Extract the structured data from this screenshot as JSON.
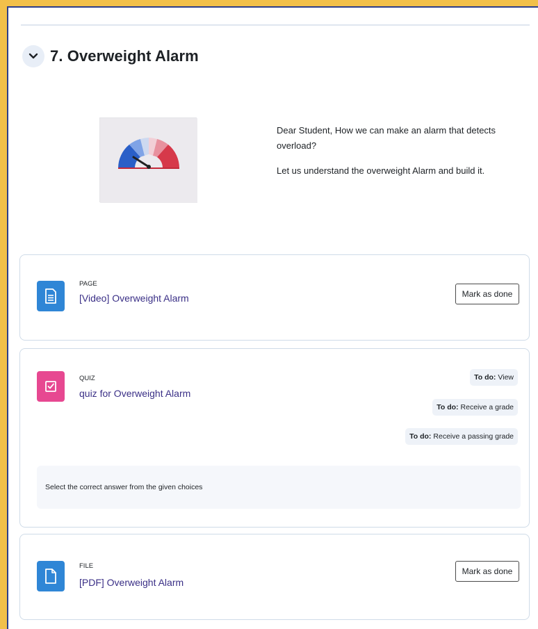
{
  "section": {
    "title": "7. Overweight Alarm",
    "summary": [
      "Dear Student, How we can make an alarm that detects overload?",
      "Let us understand the overweight Alarm and build it."
    ]
  },
  "activities": [
    {
      "type": "PAGE",
      "name": "[Video] Overweight Alarm",
      "icon": "page-icon",
      "button": "Mark as done"
    },
    {
      "type": "QUIZ",
      "name": "quiz for Overweight Alarm",
      "icon": "quiz-icon",
      "todo_prefix": "To do:",
      "todos": [
        "View",
        "Receive a grade",
        "Receive a passing grade"
      ],
      "description": "Select the correct answer from the given choices"
    },
    {
      "type": "FILE",
      "name": "[PDF] Overweight Alarm",
      "icon": "file-icon",
      "button": "Mark as done"
    }
  ],
  "colors": {
    "page_background": "#f2c04a",
    "frame_border": "#2c3e8a",
    "icon_blue": "#2f86d6",
    "icon_pink": "#e74891",
    "link": "#3a2f86"
  }
}
